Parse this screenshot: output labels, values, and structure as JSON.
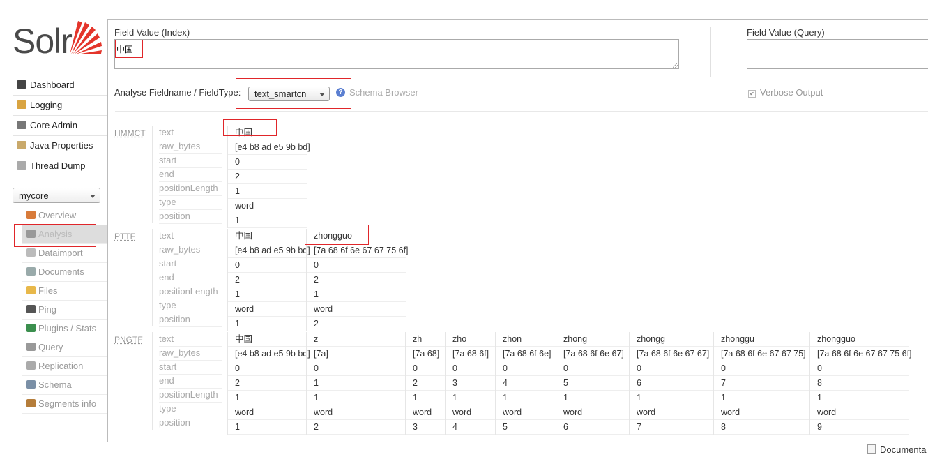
{
  "logo": {
    "text": "Solr"
  },
  "nav": [
    {
      "label": "Dashboard",
      "icon": "dashboard-icon"
    },
    {
      "label": "Logging",
      "icon": "logging-icon"
    },
    {
      "label": "Core Admin",
      "icon": "core-admin-icon"
    },
    {
      "label": "Java Properties",
      "icon": "java-properties-icon"
    },
    {
      "label": "Thread Dump",
      "icon": "thread-dump-icon"
    }
  ],
  "core_selector": {
    "value": "mycore"
  },
  "core_menu": [
    {
      "label": "Overview",
      "icon": "overview-icon"
    },
    {
      "label": "Analysis",
      "icon": "analysis-icon",
      "active": true
    },
    {
      "label": "Dataimport",
      "icon": "dataimport-icon"
    },
    {
      "label": "Documents",
      "icon": "documents-icon"
    },
    {
      "label": "Files",
      "icon": "files-icon"
    },
    {
      "label": "Ping",
      "icon": "ping-icon"
    },
    {
      "label": "Plugins / Stats",
      "icon": "plugins-icon"
    },
    {
      "label": "Query",
      "icon": "query-icon"
    },
    {
      "label": "Replication",
      "icon": "replication-icon"
    },
    {
      "label": "Schema",
      "icon": "schema-icon"
    },
    {
      "label": "Segments info",
      "icon": "segments-icon"
    }
  ],
  "analysis": {
    "index_label": "Field Value (Index)",
    "index_value": "中国",
    "query_label": "Field Value (Query)",
    "query_value": "",
    "fieldtype_label": "Analyse Fieldname / FieldType:",
    "fieldtype_value": "text_smartcn",
    "schema_browser": "Schema Browser",
    "verbose_label": "Verbose Output",
    "verbose_checked": true
  },
  "row_labels": [
    "text",
    "raw_bytes",
    "start",
    "end",
    "positionLength",
    "type",
    "position"
  ],
  "stages": [
    {
      "name": "HMMCT",
      "tokens": [
        [
          "中国",
          "[e4 b8 ad e5 9b bd]",
          "0",
          "2",
          "1",
          "word",
          "1"
        ]
      ]
    },
    {
      "name": "PTTF",
      "tokens": [
        [
          "中国",
          "[e4 b8 ad e5 9b bd]",
          "0",
          "2",
          "1",
          "word",
          "1"
        ],
        [
          "zhongguo",
          "[7a 68 6f 6e 67 67 75 6f]",
          "0",
          "2",
          "1",
          "word",
          "2"
        ]
      ]
    },
    {
      "name": "PNGTF",
      "tokens": [
        [
          "中国",
          "[e4 b8 ad e5 9b bd]",
          "0",
          "2",
          "1",
          "word",
          "1"
        ],
        [
          "z",
          "[7a]",
          "0",
          "1",
          "1",
          "word",
          "2"
        ],
        [
          "zh",
          "[7a 68]",
          "0",
          "2",
          "1",
          "word",
          "3"
        ],
        [
          "zho",
          "[7a 68 6f]",
          "0",
          "3",
          "1",
          "word",
          "4"
        ],
        [
          "zhon",
          "[7a 68 6f 6e]",
          "0",
          "4",
          "1",
          "word",
          "5"
        ],
        [
          "zhong",
          "[7a 68 6f 6e 67]",
          "0",
          "5",
          "1",
          "word",
          "6"
        ],
        [
          "zhongg",
          "[7a 68 6f 6e 67 67]",
          "0",
          "6",
          "1",
          "word",
          "7"
        ],
        [
          "zhonggu",
          "[7a 68 6f 6e 67 67 75]",
          "0",
          "7",
          "1",
          "word",
          "8"
        ],
        [
          "zhongguo",
          "[7a 68 6f 6e 67 67 75 6f]",
          "0",
          "8",
          "1",
          "word",
          "9"
        ]
      ]
    }
  ],
  "footer": {
    "documentation": "Documenta"
  },
  "colors": {
    "highlight_box": "#e0262a",
    "logo_ray": "#e4352b"
  }
}
